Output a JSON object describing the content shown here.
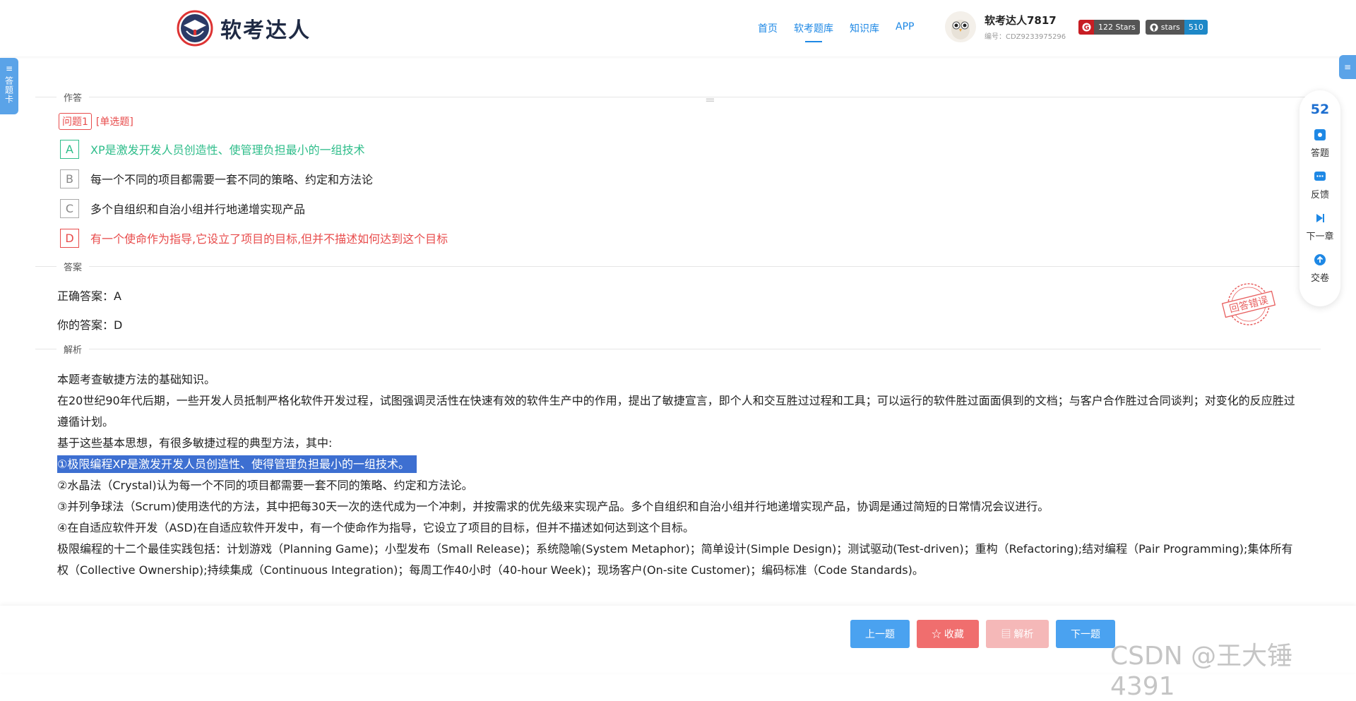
{
  "header": {
    "logo_text": "软考达人",
    "nav": [
      "首页",
      "软考题库",
      "知识库",
      "APP"
    ],
    "active_nav_index": 1,
    "user": {
      "name": "软考达人7817",
      "id": "编号：CDZ9233975296"
    },
    "badges": {
      "gitee_stars": "122 Stars",
      "github_label": "stars",
      "github_count": "510"
    }
  },
  "left_tab": {
    "label": "答题卡"
  },
  "sections": {
    "answer_title": "作答",
    "result_title": "答案",
    "analysis_title": "解析"
  },
  "question": {
    "number_tag": "问题1",
    "type_tag": "[单选题]",
    "options": [
      {
        "key": "A",
        "text": "XP是激发开发人员创造性、使管理负担最小的一组技术",
        "state": "correct"
      },
      {
        "key": "B",
        "text": "每一个不同的项目都需要一套不同的策略、约定和方法论",
        "state": "normal"
      },
      {
        "key": "C",
        "text": "多个自组织和自治小组并行地递增实现产品",
        "state": "normal"
      },
      {
        "key": "D",
        "text": "有一个使命作为指导,它设立了项目的目标,但并不描述如何达到这个目标",
        "state": "wrong"
      }
    ]
  },
  "result": {
    "correct_label": "正确答案：",
    "correct_value": "A",
    "yours_label": "你的答案：",
    "yours_value": "D",
    "stamp_text": "回答错误"
  },
  "analysis": {
    "p1": "本题考查敏捷方法的基础知识。",
    "p2": "在20世纪90年代后期，一些开发人员抵制严格化软件开发过程，试图强调灵活性在快速有效的软件生产中的作用，提出了敏捷宣言，即个人和交互胜过过程和工具；可以运行的软件胜过面面俱到的文档；与客户合作胜过合同谈判；对变化的反应胜过遵循计划。",
    "p3": "基于这些基本思想，有很多敏捷过程的典型方法，其中:",
    "p4": "①极限编程XP是激发开发人员创造性、使得管理负担最小的一组技术。",
    "p5": "②水晶法（Crystal)认为每一个不同的项目都需要一套不同的策略、约定和方法论。",
    "p6": "③并列争球法（Scrum)使用迭代的方法，其中把每30天一次的迭代成为一个冲刺，并按需求的优先级来实现产品。多个自组织和自治小组并行地递增实现产品，协调是通过简短的日常情况会议进行。",
    "p7": "④在自适应软件开发（ASD)在自适应软件开发中，有一个使命作为指导，它设立了项目的目标，但并不描述如何达到这个目标。",
    "p8": "极限编程的十二个最佳实践包括：计划游戏（Planning Game)；小型发布（Small Release)；系统隐喻(System Metaphor)；简单设计(Simple Design)；测试驱动(Test-driven)；重构（Refactoring);结对编程（Pair Programming);集体所有权（Collective Ownership);持续集成（Continuous Integration)；每周工作40小时（40-hour Week)；现场客户(On-site Customer)；编码标准（Code Standards)。"
  },
  "float_panel": {
    "count": "52",
    "items": [
      "答题",
      "反馈",
      "下一章",
      "交卷"
    ]
  },
  "bottom": {
    "prev": "上一题",
    "fav": "☆ 收藏",
    "analysis": "▤ 解析",
    "next": "下一题",
    "watermark": "CSDN @王大锤4391"
  },
  "colors": {
    "primary": "#1e88e5",
    "correct": "#2ebd8a",
    "wrong": "#e84c4c",
    "highlight": "#3d6fd1"
  }
}
